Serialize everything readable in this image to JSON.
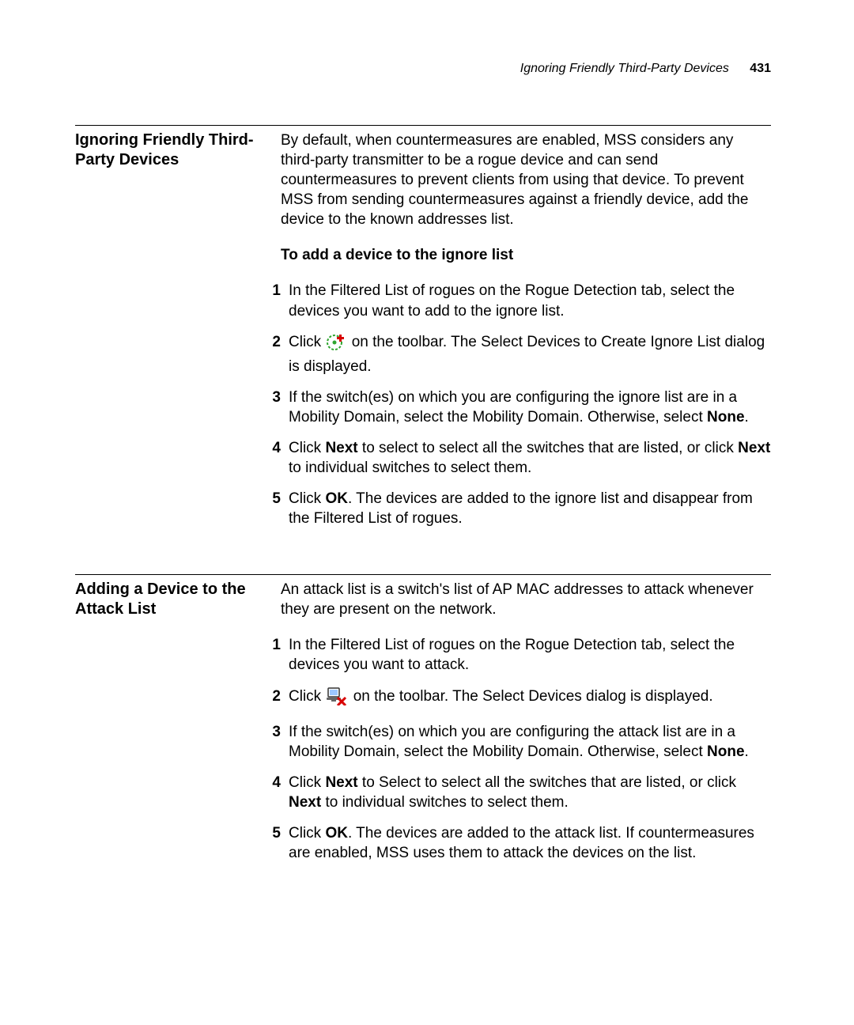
{
  "header": {
    "title": "Ignoring Friendly Third-Party Devices",
    "pageNumber": "431"
  },
  "section1": {
    "heading": "Ignoring Friendly Third-Party Devices",
    "intro": "By default, when countermeasures are enabled, MSS considers any third-party transmitter to be a rogue device and can send countermeasures to prevent clients from using that device. To prevent MSS from sending countermeasures against a friendly device, add the device to the known addresses list.",
    "subheading": "To add a device to the ignore list",
    "steps": {
      "s1": "In the Filtered List of rogues on the Rogue Detection tab, select the devices you want to add to the ignore list.",
      "s2a": "Click ",
      "s2b": " on the toolbar. The Select Devices to Create Ignore List dialog is displayed.",
      "s3a": "If the switch(es) on which you are configuring the ignore list are in a Mobility Domain, select the Mobility Domain. Otherwise, select ",
      "s3b": "None",
      "s3c": ".",
      "s4a": "Click ",
      "s4b": "Next",
      "s4c": " to select to select all the switches that are listed, or click ",
      "s4d": "Next",
      "s4e": " to individual switches to select them.",
      "s5a": "Click ",
      "s5b": "OK",
      "s5c": ". The devices are added to the ignore list and disappear from the Filtered List of rogues."
    }
  },
  "section2": {
    "heading": "Adding a Device to the Attack List",
    "intro": "An attack list is a switch's list of AP MAC addresses to attack whenever they are present on the network.",
    "steps": {
      "s1": "In the Filtered List of rogues on the Rogue Detection tab, select the devices you want to attack.",
      "s2a": "Click ",
      "s2b": " on the toolbar. The Select Devices dialog is displayed.",
      "s3a": "If the switch(es) on which you are configuring the attack list are in a Mobility Domain, select the Mobility Domain. Otherwise, select ",
      "s3b": "None",
      "s3c": ".",
      "s4a": "Click ",
      "s4b": "Next",
      "s4c": " to Select to select all the switches that are listed, or click ",
      "s4d": "Next",
      "s4e": " to individual switches to select them.",
      "s5a": "Click ",
      "s5b": "OK",
      "s5c": ". The devices are added to the attack list. If countermeasures are enabled, MSS uses them to attack the devices on the list."
    }
  }
}
